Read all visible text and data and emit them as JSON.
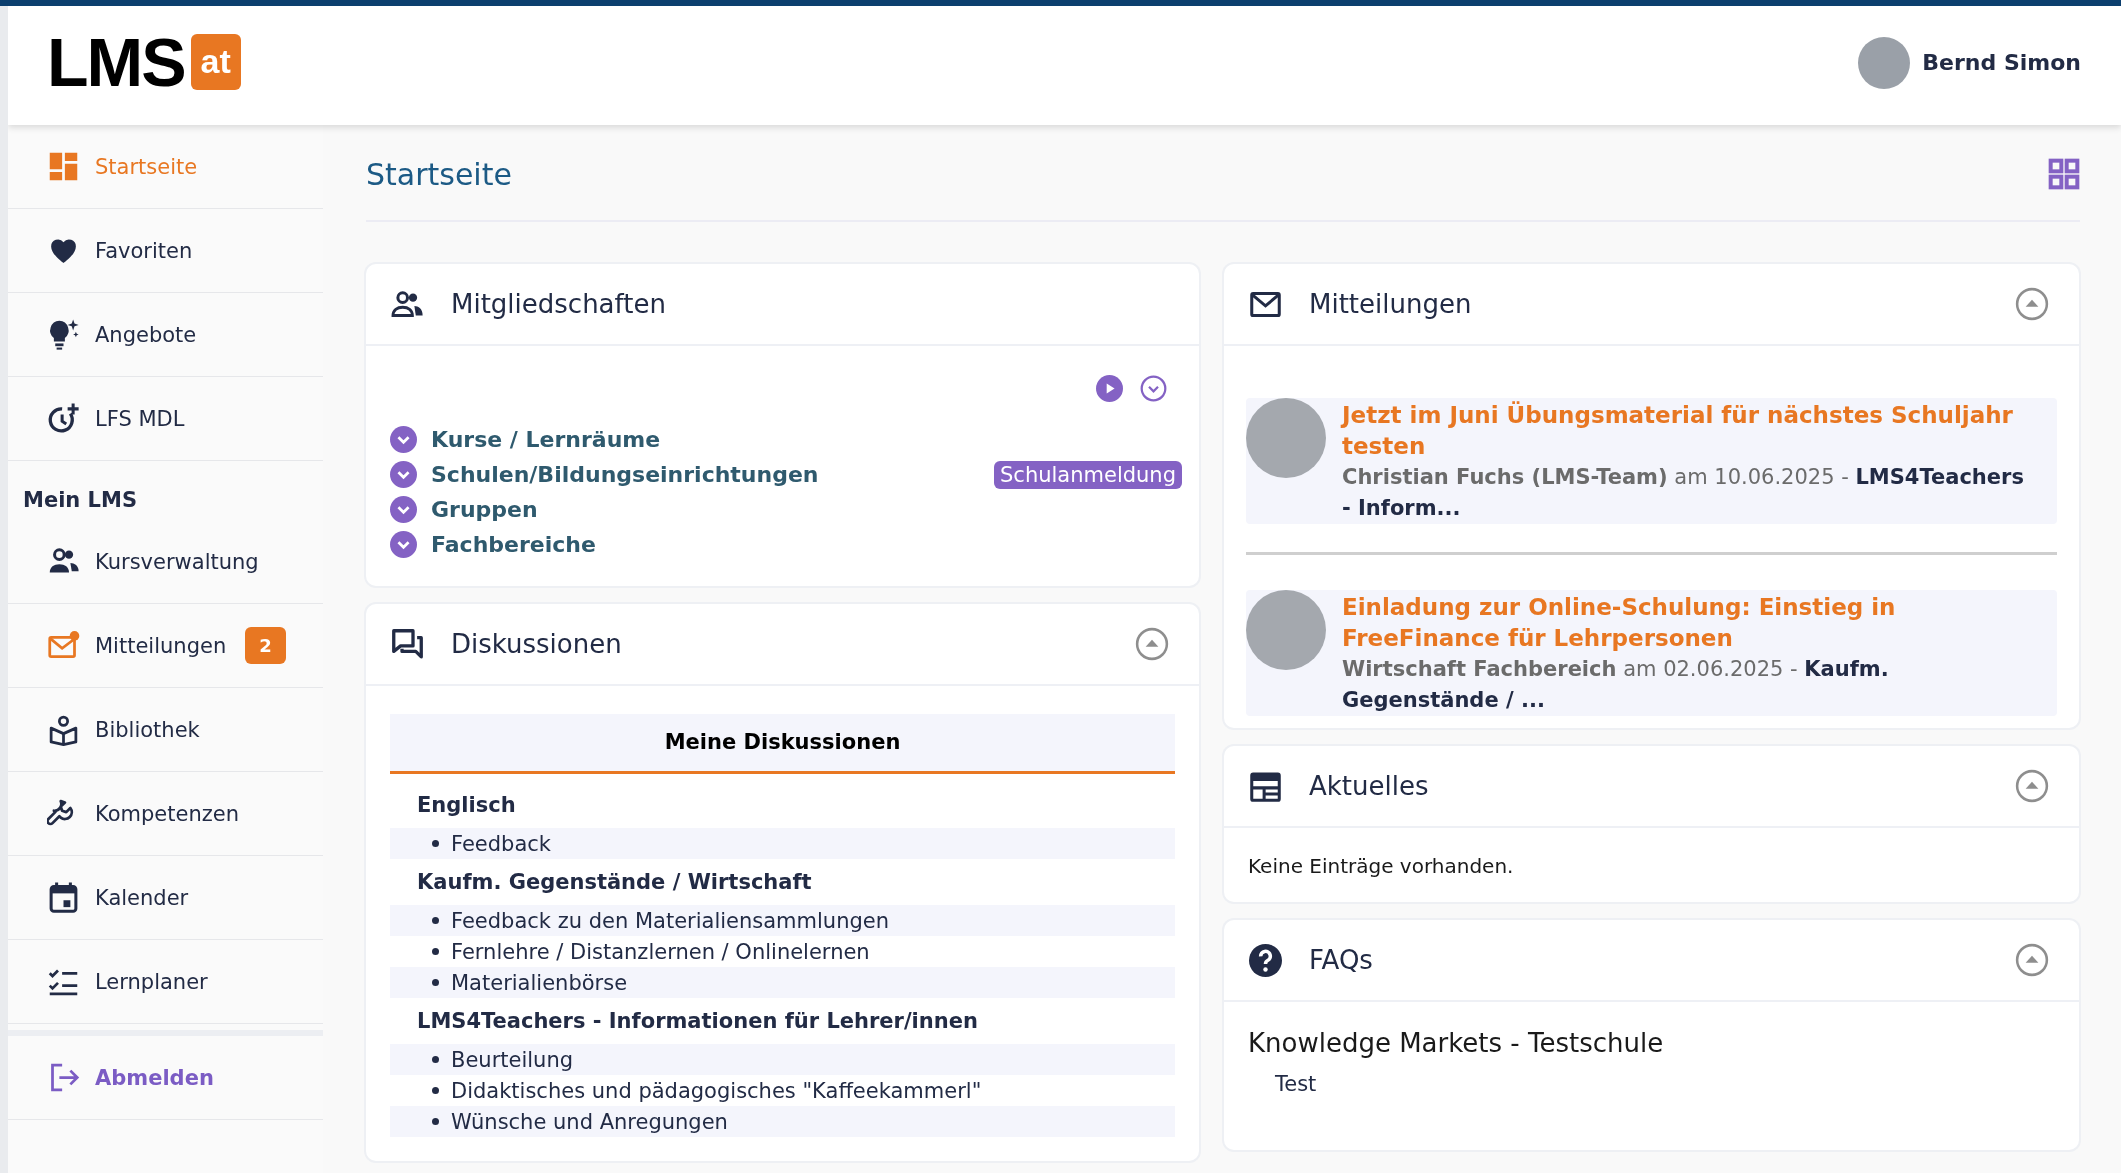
{
  "header": {
    "logo": {
      "text": "LMS",
      "badge": "at"
    },
    "user": {
      "name": "Bernd Simon"
    }
  },
  "sidebar": {
    "items": [
      {
        "label": "Startseite",
        "selected": true
      },
      {
        "label": "Favoriten",
        "selected": false
      },
      {
        "label": "Angebote",
        "selected": false
      },
      {
        "label": "LFS MDL",
        "selected": false
      }
    ],
    "section": {
      "heading": "Mein LMS",
      "items": [
        {
          "label": "Kursverwaltung",
          "selected": false
        },
        {
          "label": "Mitteilungen",
          "selected": false,
          "badge": "2"
        },
        {
          "label": "Bibliothek",
          "selected": false
        },
        {
          "label": "Kompetenzen",
          "selected": false
        },
        {
          "label": "Kalender",
          "selected": false
        },
        {
          "label": "Lernplaner",
          "selected": false
        }
      ]
    },
    "logout": {
      "label": "Abmelden"
    }
  },
  "page_title": "Startseite",
  "memberships": {
    "title": "Mitgliedschaften",
    "categories": [
      {
        "label": "Kurse / Lernräume",
        "expanded": false
      },
      {
        "label": "Schulen/Bildungseinrichtungen",
        "expanded": false,
        "action": "Schulanmeldung"
      },
      {
        "label": "Gruppen",
        "expanded": false
      },
      {
        "label": "Fachbereiche",
        "expanded": false
      }
    ]
  },
  "discussions": {
    "title": "Diskussionen",
    "expanded": true,
    "tabs": [
      {
        "label": "Meine Diskussionen",
        "selected": true
      }
    ],
    "groups": [
      {
        "name": "Englisch",
        "topics": [
          "Feedback"
        ]
      },
      {
        "name": "Kaufm. Gegenstände / Wirtschaft",
        "topics": [
          "Feedback zu den Materialiensammlungen",
          "Fernlehre / Distanzlernen / Onlinelernen",
          "Materialienbörse"
        ]
      },
      {
        "name": "LMS4Teachers - Informationen für Lehrer/innen",
        "topics": [
          "Beurteilung",
          "Didaktisches und pädagogisches \"Kaffeekammerl\"",
          "Wünsche und Anregungen"
        ]
      }
    ]
  },
  "messages": {
    "title": "Mitteilungen",
    "expanded": true,
    "items": [
      {
        "title": "Jetzt im Juni Übungsmaterial für nächstes Schuljahr testen",
        "meta": "**Christian Fuchs (LMS-Team)** am 10.06.2025 - **LMS4Teachers - Inform...**"
      },
      {
        "title": "Einladung zur Online-Schulung: Einstieg in FreeFinance für Lehrpersonen",
        "meta": "**Wirtschaft Fachbereich** am 02.06.2025 - **Kaufm. Gegenstände / ...**"
      }
    ]
  },
  "news": {
    "title": "Aktuelles",
    "expanded": true,
    "empty_text": "Keine Einträge vorhanden."
  },
  "faqs": {
    "title": "FAQs",
    "expanded": true,
    "heading": "Knowledge Markets - Testschule",
    "items": [
      "Test"
    ]
  }
}
